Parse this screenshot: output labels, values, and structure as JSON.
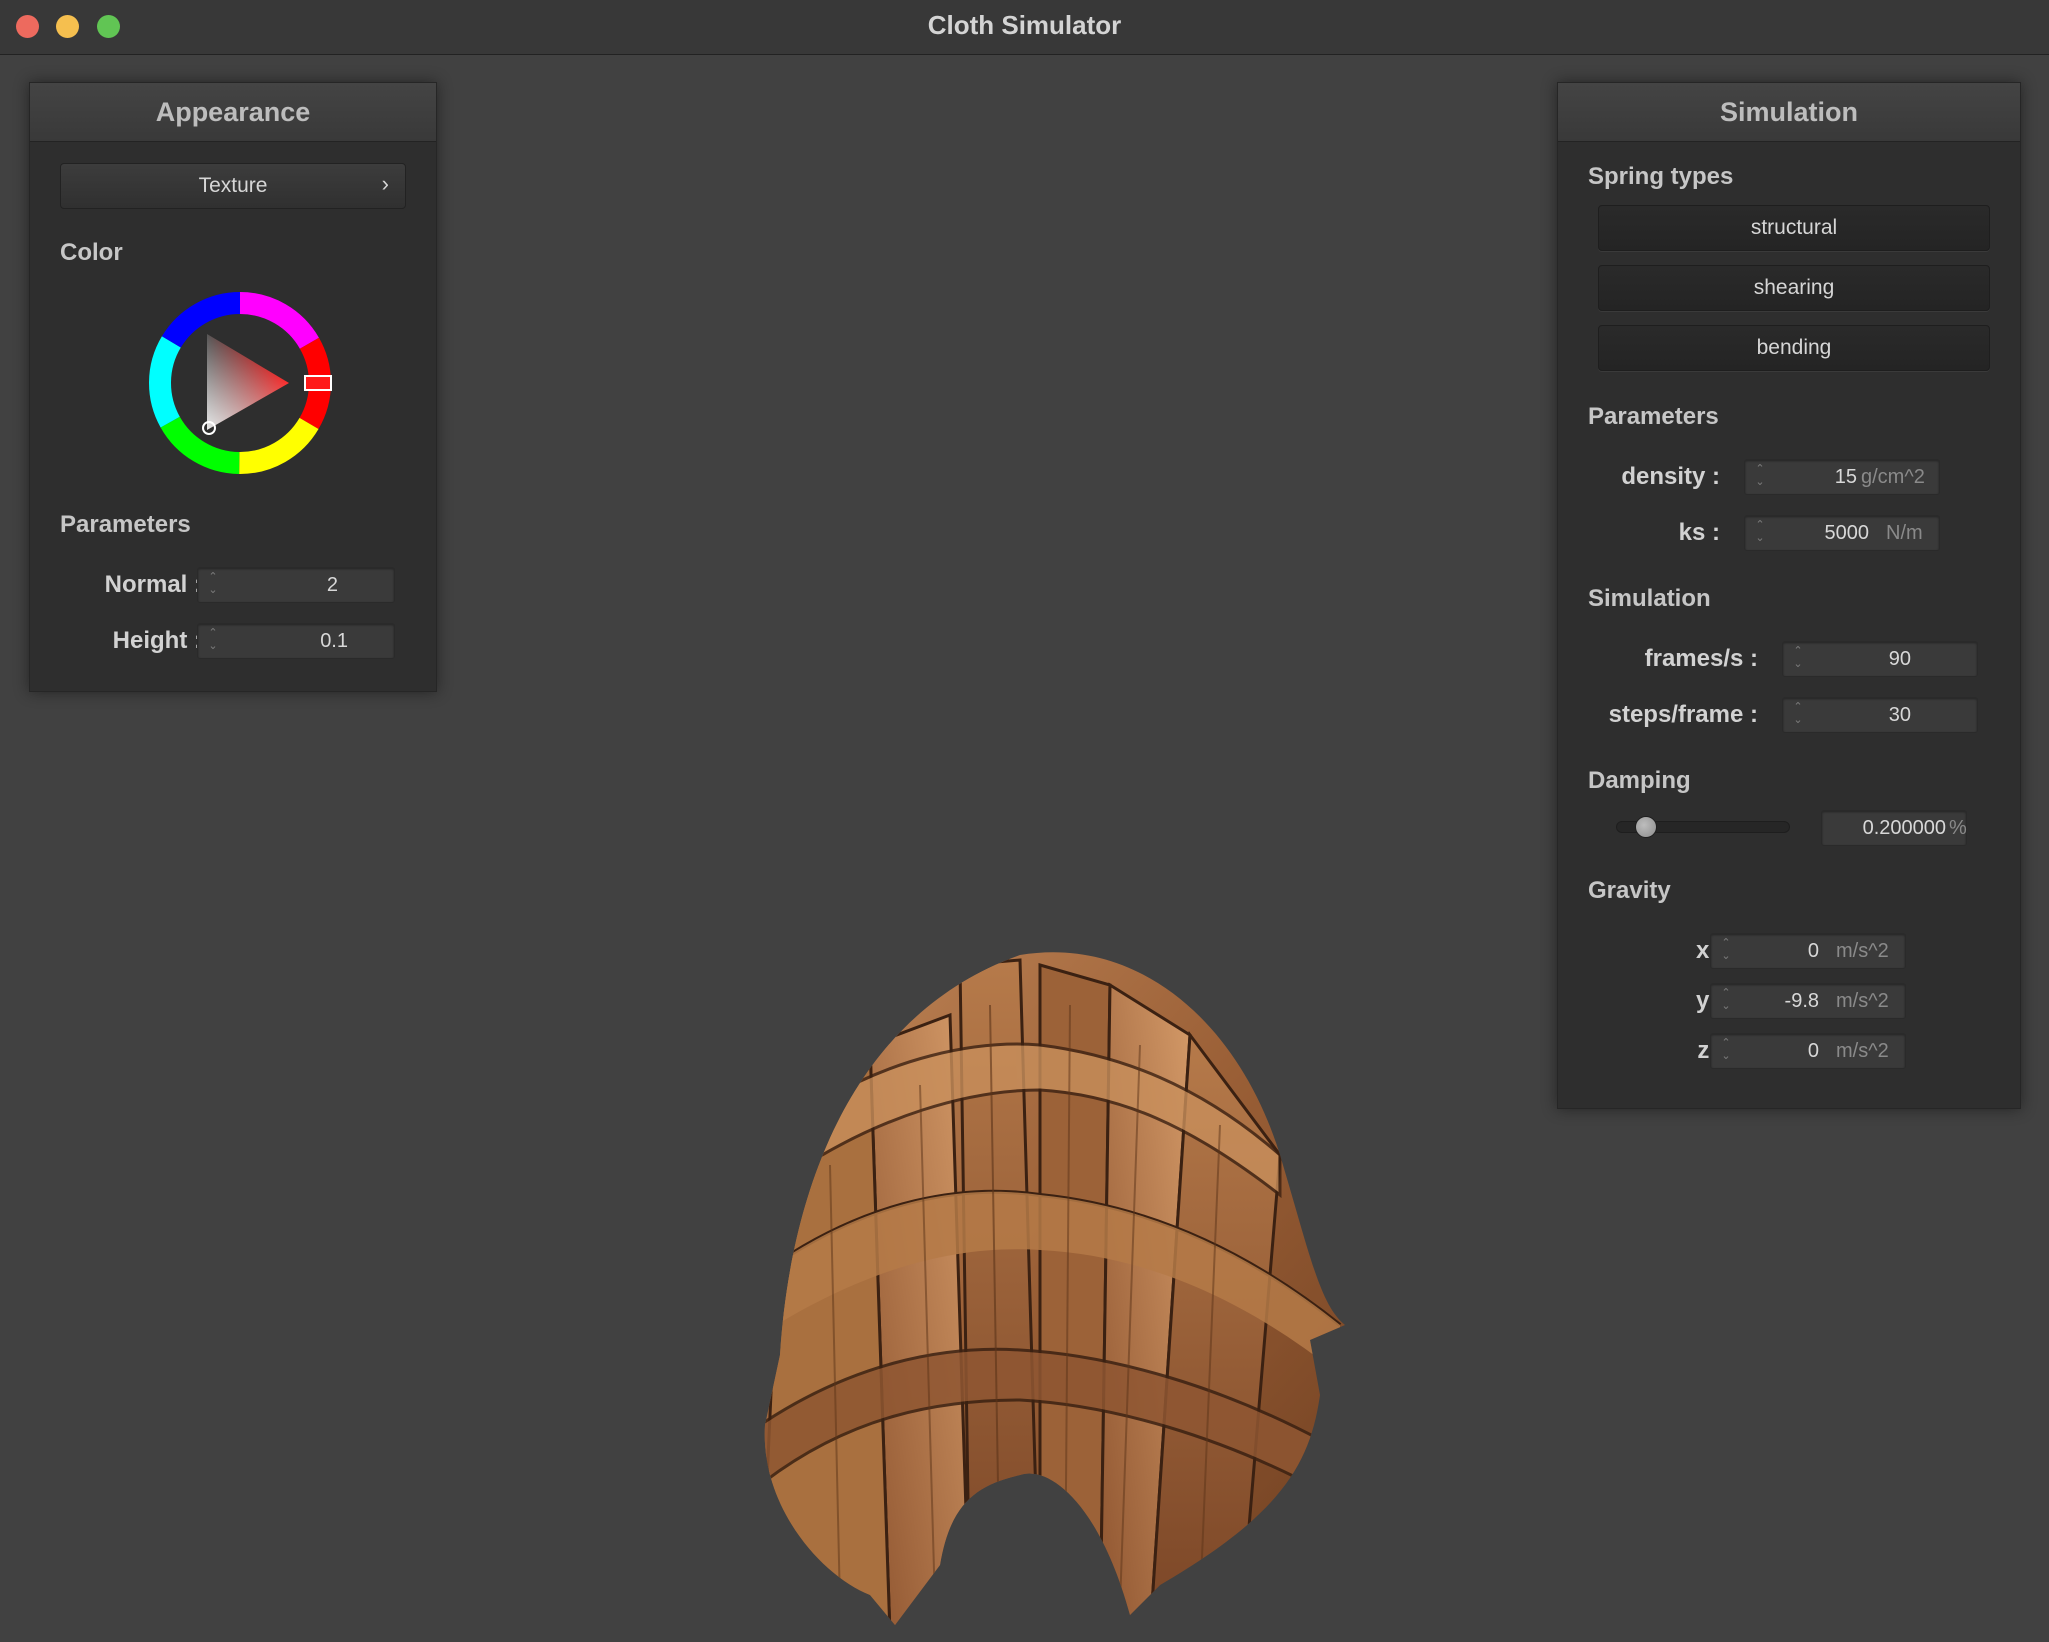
{
  "window": {
    "title": "Cloth Simulator"
  },
  "appearance": {
    "header": "Appearance",
    "texture_button": "Texture",
    "texture_chevron": "›",
    "color_label": "Color",
    "parameters_label": "Parameters",
    "normal_label": "Normal :",
    "normal_value": "2",
    "height_label": "Height :",
    "height_value": "0.1",
    "selected_color": "#ff0000"
  },
  "simulation": {
    "header": "Simulation",
    "spring_types_label": "Spring types",
    "spring_buttons": [
      "structural",
      "shearing",
      "bending"
    ],
    "parameters_label": "Parameters",
    "density_label": "density :",
    "density_value": "15",
    "density_unit": "g/cm^2",
    "ks_label": "ks :",
    "ks_value": "5000",
    "ks_unit": "N/m",
    "simulation_label": "Simulation",
    "fps_label": "frames/s :",
    "fps_value": "90",
    "steps_label": "steps/frame :",
    "steps_value": "30",
    "damping_label": "Damping",
    "damping_value": "0.200000",
    "damping_unit": "%",
    "damping_level": 0.2,
    "gravity_label": "Gravity",
    "gx_label": "x :",
    "gx_value": "0",
    "gy_label": "y :",
    "gy_value": "-9.8",
    "gz_label": "z :",
    "gz_value": "0",
    "gravity_unit": "m/s^2"
  },
  "colors": {
    "background": "#414141",
    "panel": "#2e2e2e",
    "cloth_wood": "#a0643a"
  }
}
